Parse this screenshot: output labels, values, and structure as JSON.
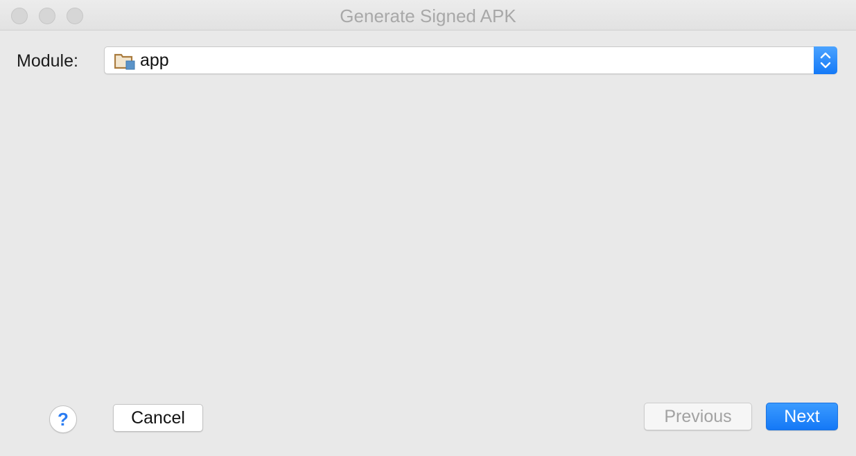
{
  "window": {
    "title": "Generate Signed APK"
  },
  "module": {
    "label": "Module:",
    "selected_value": "app",
    "icon": "module-folder-icon"
  },
  "footer": {
    "help_label": "?",
    "cancel_label": "Cancel",
    "previous_label": "Previous",
    "next_label": "Next"
  },
  "colors": {
    "accent": "#1a7ff7",
    "background": "#e9e9e9",
    "disabled_text": "#a2a2a2"
  }
}
